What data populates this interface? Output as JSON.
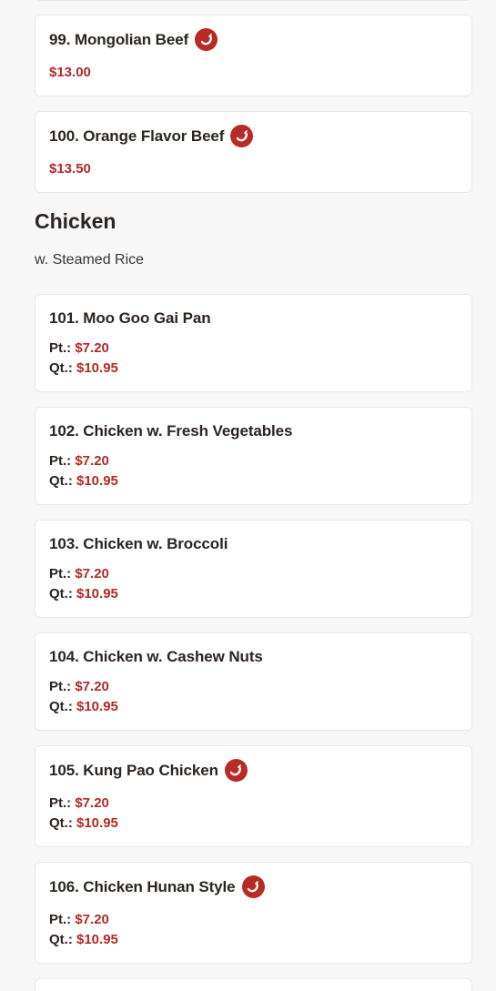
{
  "colors": {
    "price": "#b12a26",
    "spicy_icon_bg": "#b82a24",
    "page_bg": "#f7f7f7",
    "card_bg": "#ffffff"
  },
  "beef_items": [
    {
      "name": "99. Mongolian Beef",
      "price": "$13.00",
      "spicy": true
    },
    {
      "name": "100. Orange Flavor Beef",
      "price": "$13.50",
      "spicy": true
    }
  ],
  "section": {
    "title": "Chicken",
    "subtitle": "w. Steamed Rice"
  },
  "size_labels": {
    "pint": "Pt.:",
    "quart": "Qt.:"
  },
  "chicken_items": [
    {
      "name": "101. Moo Goo Gai Pan",
      "pint": "$7.20",
      "quart": "$10.95",
      "spicy": false
    },
    {
      "name": "102. Chicken w. Fresh Vegetables",
      "pint": "$7.20",
      "quart": "$10.95",
      "spicy": false
    },
    {
      "name": "103. Chicken w. Broccoli",
      "pint": "$7.20",
      "quart": "$10.95",
      "spicy": false
    },
    {
      "name": "104. Chicken w. Cashew Nuts",
      "pint": "$7.20",
      "quart": "$10.95",
      "spicy": false
    },
    {
      "name": "105. Kung Pao Chicken",
      "pint": "$7.20",
      "quart": "$10.95",
      "spicy": true
    },
    {
      "name": "106. Chicken Hunan Style",
      "pint": "$7.20",
      "quart": "$10.95",
      "spicy": true
    }
  ]
}
